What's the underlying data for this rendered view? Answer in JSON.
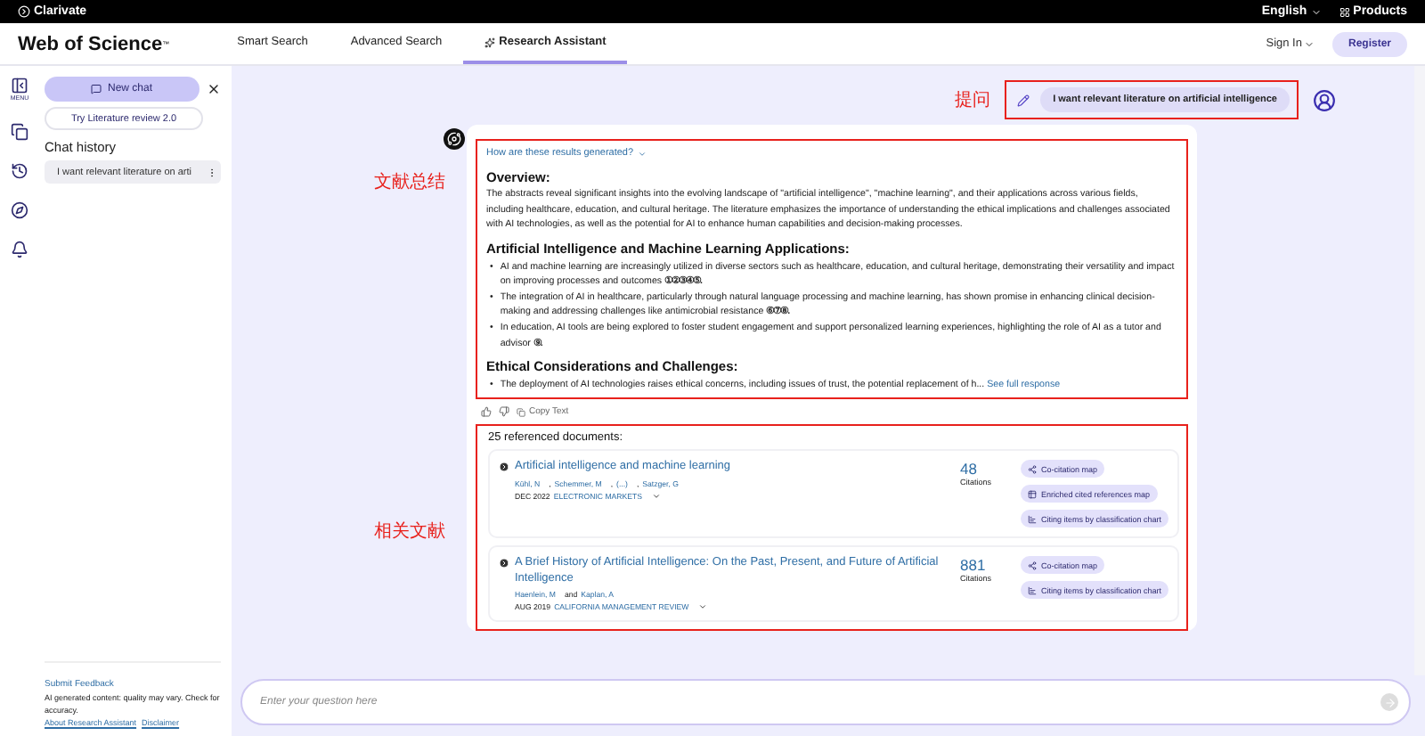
{
  "top_bar": {
    "brand": "Clarivate",
    "language": "English",
    "products": "Products"
  },
  "header": {
    "logo": "Web of Science",
    "logo_mark": "™",
    "tabs": [
      {
        "label": "Smart Search",
        "selected": false
      },
      {
        "label": "Advanced Search",
        "selected": false
      },
      {
        "label": "Research Assistant",
        "selected": true
      }
    ],
    "sign_in": "Sign In",
    "register": "Register"
  },
  "rail": {
    "menu_label": "MENU"
  },
  "sidebar": {
    "new_chat": "New chat",
    "literature_review": "Try Literature review 2.0",
    "history_title": "Chat history",
    "history": [
      {
        "label": "I want relevant literature on arti"
      }
    ],
    "feedback": "Submit Feedback",
    "disclaimer_text": "AI generated content: quality may vary. Check for accuracy.",
    "links": [
      "About Research Assistant",
      "Disclaimer"
    ]
  },
  "annotations": {
    "question": "提问",
    "summary": "文献总结",
    "references": "相关文献"
  },
  "question": "I want relevant literature on artificial intelligence",
  "response": {
    "how_link": "How are these results generated?",
    "sections": [
      {
        "heading": "Overview:",
        "paragraphs": [
          "The abstracts reveal significant insights into the evolving landscape of \"artificial intelligence\", \"machine learning\", and their applications across various fields, including healthcare, education, and cultural heritage. The literature emphasizes the importance of understanding the ethical implications and challenges associated with AI technologies, as well as the potential for AI to enhance human capabilities and decision-making processes."
        ]
      },
      {
        "heading": "Artificial Intelligence and Machine Learning Applications:",
        "bullets": [
          {
            "marker": "•",
            "text": "AI and machine learning are increasingly utilized in diverse sectors such as healthcare, education, and cultural heritage, demonstrating their versatility and impact on improving processes and outcomes",
            "citations": "①②③④⑤."
          },
          {
            "marker": "•",
            "text": "The integration of AI in healthcare, particularly through natural language processing and machine learning, has shown promise in enhancing clinical decision-making and addressing challenges like antimicrobial resistance",
            "citations": "⑥⑦⑧."
          },
          {
            "marker": "•",
            "text": "In education, AI tools are being explored to foster student engagement and support personalized learning experiences, highlighting the role of AI as a tutor and advisor",
            "citations": "⑨."
          }
        ]
      },
      {
        "heading": "Ethical Considerations and Challenges:",
        "bullets": [
          {
            "marker": "•",
            "text": "The deployment of AI technologies raises ethical concerns, including issues of trust, the potential replacement of h...",
            "link": "See full response"
          }
        ]
      }
    ],
    "copy": "Copy Text"
  },
  "references": {
    "title": "25 referenced documents:",
    "documents": [
      {
        "title": "Artificial intelligence and machine learning",
        "authors": [
          {
            "name": "Kühl, N",
            "separator": ","
          },
          {
            "name": "Schemmer, M",
            "separator": ","
          },
          {
            "name": "(...)",
            "separator": ","
          },
          {
            "name": "Satzger, G"
          }
        ],
        "date": "DEC 2022",
        "journal": "ELECTRONIC MARKETS",
        "citations": "48",
        "citations_label": "Citations",
        "actions": [
          {
            "kind": "cocitation",
            "label": "Co-citation map"
          },
          {
            "kind": "enriched",
            "label": "Enriched cited references map"
          },
          {
            "kind": "classification",
            "label": "Citing items by classification chart"
          }
        ]
      },
      {
        "title": "A Brief History of Artificial Intelligence: On the Past, Present, and Future of Artificial Intelligence",
        "authors": [
          {
            "name": "Haenlein, M",
            "separator": "and"
          },
          {
            "name": "Kaplan, A"
          }
        ],
        "date": "AUG 2019",
        "journal": "CALIFORNIA MANAGEMENT REVIEW",
        "citations": "881",
        "citations_label": "Citations",
        "actions": [
          {
            "kind": "cocitation",
            "label": "Co-citation map"
          },
          {
            "kind": "classification",
            "label": "Citing items by classification chart"
          }
        ]
      }
    ]
  },
  "input": {
    "placeholder": "Enter your question here"
  }
}
